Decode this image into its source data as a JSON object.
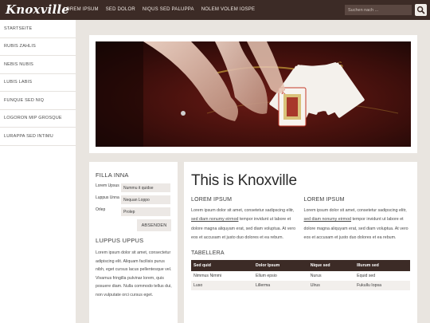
{
  "header": {
    "logo": "Knoxville",
    "nav": [
      "LOREM IPSUM",
      "SED DOLOR",
      "NIQUS SED PALUPPA",
      "NOLEM VOLEM IOSPE"
    ],
    "search_placeholder": "Suchen nach ..."
  },
  "sidebar": {
    "items": [
      "STARTSEITE",
      "RUBIS ZAHLIS",
      "NEBIS NUBIS",
      "LUBIS LABIS",
      "FUNQUE SED NIQ",
      "LOGORON MIP GROSQUE",
      "LURAPPA SED INTIMU"
    ]
  },
  "widget": {
    "title": "FILLA INNA",
    "fields": [
      {
        "label": "Lorem Upsus",
        "value": "Nummu it quidse"
      },
      {
        "label": "Luppus Unna",
        "value": "Nequan Loppo"
      },
      {
        "label": "Orlep",
        "value": "Prolep"
      }
    ],
    "submit": "ABSENDEN",
    "title2": "LUPPUS UPPUS",
    "text": "Lorem ipsum dolor sit amet, consectetur adipiscing elit. Aliquam facilisis purus nibh, eget cursus lacus pellentesque vel. Vivamus fringilla pulvinar lorem, quis posuere diam. Nulla commodo tellus dui, non vulputate orci cursus eget."
  },
  "main": {
    "title": "This is Knoxville",
    "col1": {
      "title": "LOREM IPSUM",
      "text_before": "Lorem ipsum dolor sit amet, consetetur sadipscing elitr, ",
      "link": "sed diam nonumy eirmod",
      "text_after": " tempor invidunt ut labore et dolore magna aliquyam erat, sed diam voluptua. At vero eos et accusam et justo duo dolores et ea rebum."
    },
    "col2": {
      "title": "LOREM IPSUM",
      "text_before": "Lorem ipsum dolor sit amet, consetetur sadipscing elitr, ",
      "link": "sed diam nonumy eirmod",
      "text_after": " tempor invidunt ut labore et dolore magna aliquyam erat, sed diam voluptua. At vero eos et accusam et justo duo dolores et ea rebum."
    },
    "table": {
      "title": "TABELLERA",
      "headers": [
        "Sed quid",
        "Dolor Ipsum",
        "Nique sed",
        "Illurum sed"
      ],
      "rows": [
        [
          "Nimmus Nimmi",
          "Ellum epsio",
          "Nurus",
          "Equid sed"
        ],
        [
          "Luso",
          "Lillerma",
          "Ulrus",
          "Fukullu Iopsa"
        ]
      ]
    }
  },
  "colors": {
    "brown": "#3c2b26",
    "background": "#e9e5e0"
  }
}
